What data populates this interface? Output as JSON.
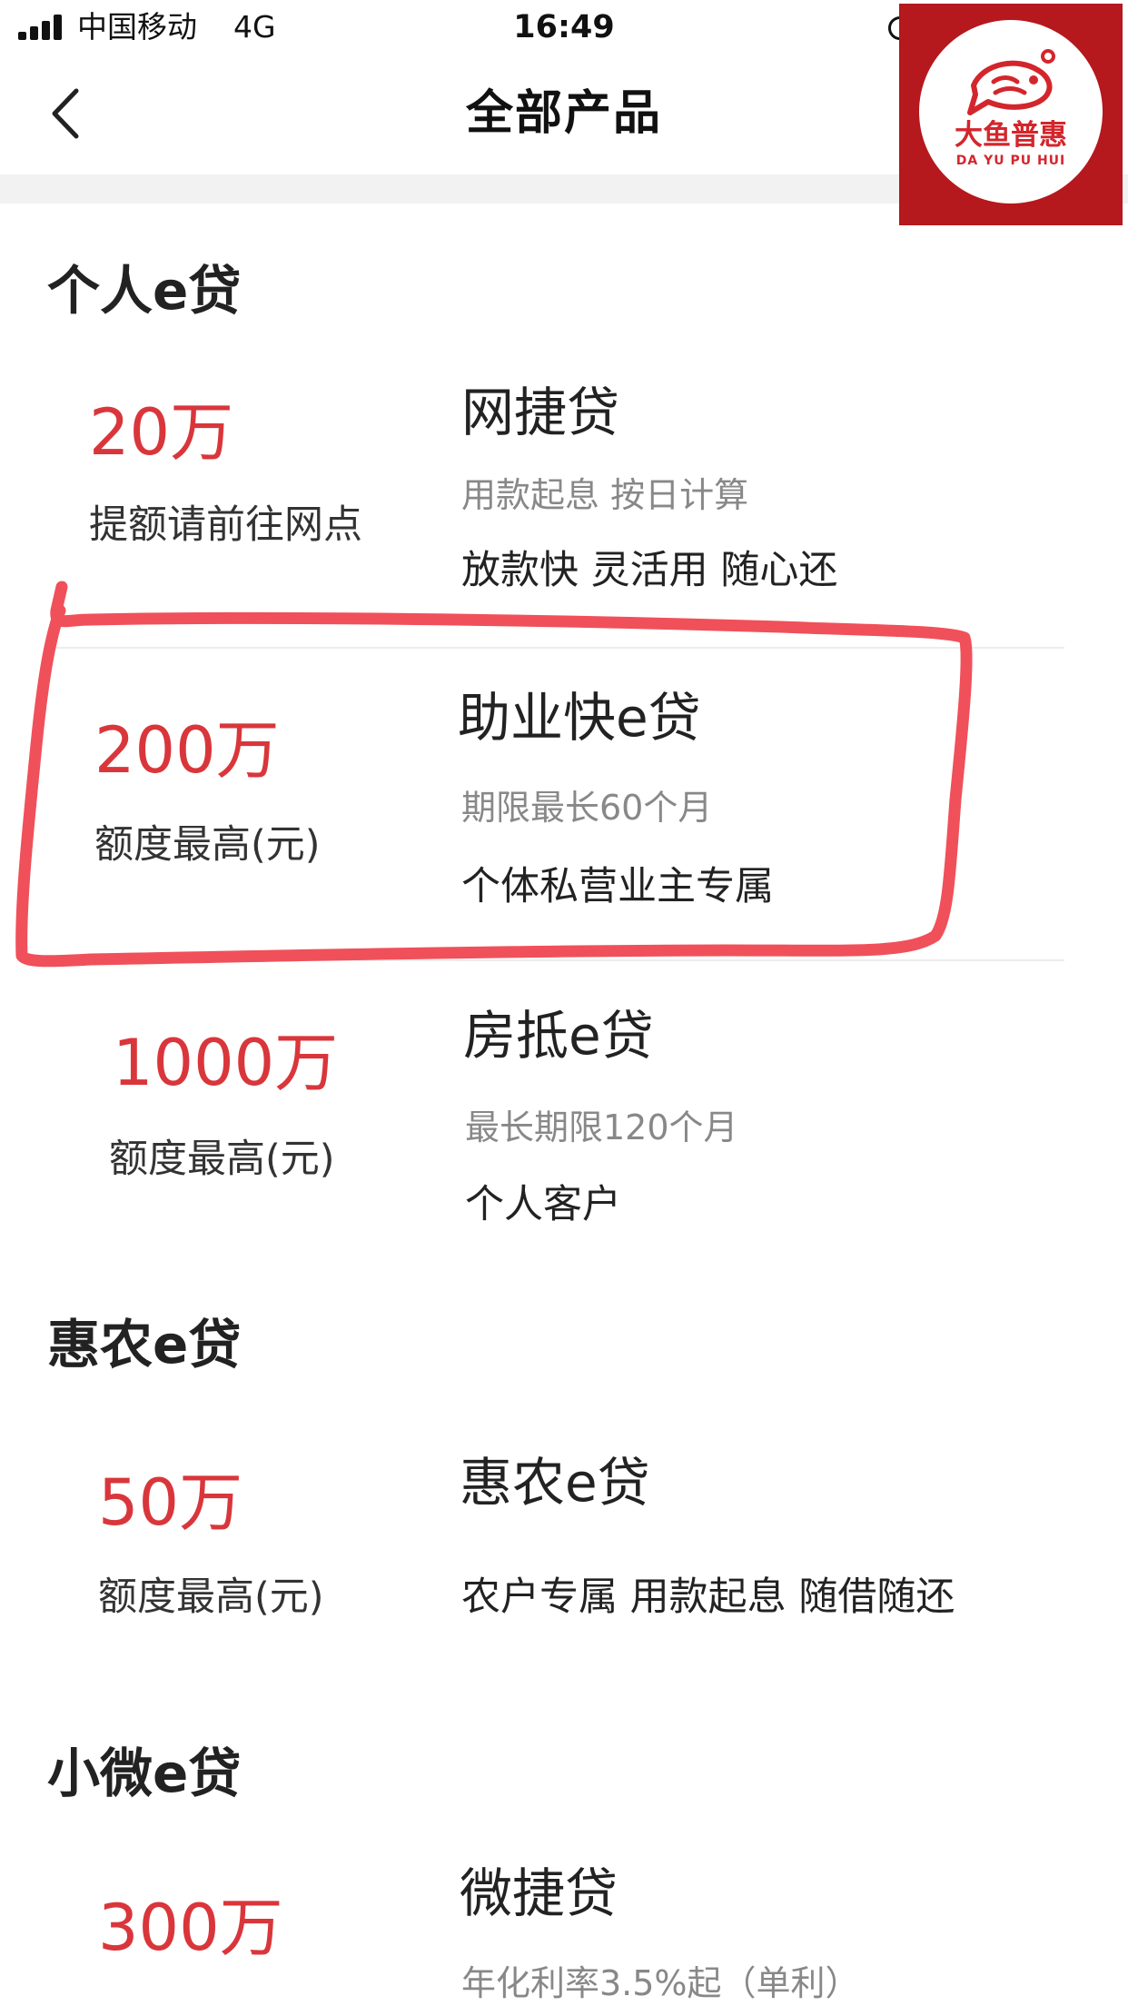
{
  "status_bar": {
    "carrier": "中国移动",
    "network": "4G",
    "time": "16:49"
  },
  "nav": {
    "title": "全部产品"
  },
  "brand": {
    "name": "大鱼普惠",
    "sub": "DA YU PU HUI",
    "color": "#b5181d"
  },
  "sections": [
    {
      "title": "个人e贷",
      "products": [
        {
          "amount": "20万",
          "amount_label": "提额请前往网点",
          "name": "网捷贷",
          "desc": "用款起息 按日计算",
          "tags": "放款快 灵活用 随心还"
        },
        {
          "amount": "200万",
          "amount_label": "额度最高(元)",
          "name": "助业快e贷",
          "desc": "期限最长60个月",
          "tags": "个体私营业主专属"
        },
        {
          "amount": "1000万",
          "amount_label": "额度最高(元)",
          "name": "房抵e贷",
          "desc": "最长期限120个月",
          "tags": "个人客户"
        }
      ]
    },
    {
      "title": "惠农e贷",
      "products": [
        {
          "amount": "50万",
          "amount_label": "额度最高(元)",
          "name": "惠农e贷",
          "tags": "农户专属 用款起息 随借随还"
        }
      ]
    },
    {
      "title": "小微e贷",
      "products": [
        {
          "amount": "300万",
          "name": "微捷贷",
          "desc": "年化利率3.5%起（单利）"
        }
      ]
    }
  ],
  "colors": {
    "amount": "#d9363b",
    "highlight": "#f0505a"
  }
}
